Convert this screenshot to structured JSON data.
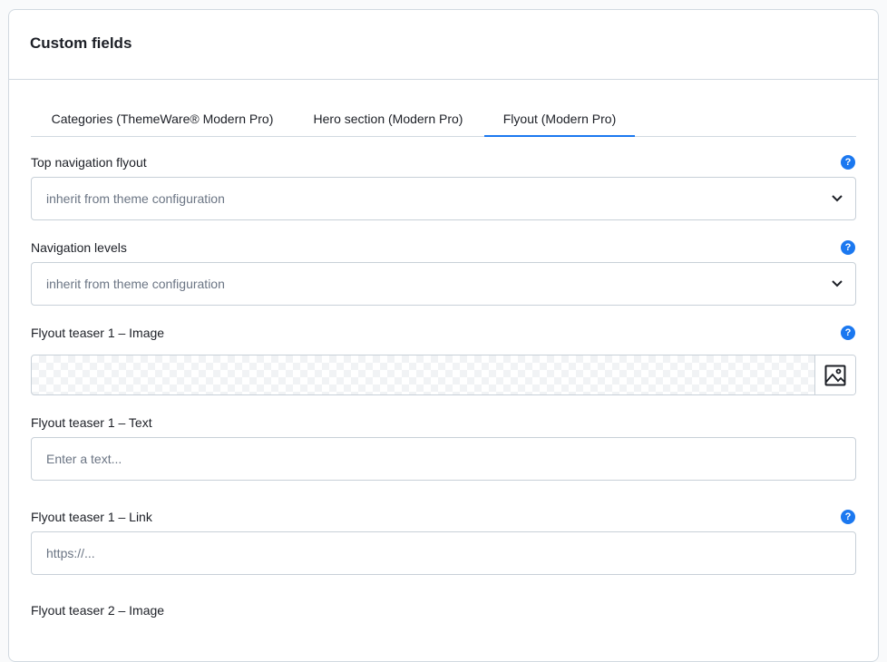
{
  "card": {
    "title": "Custom fields"
  },
  "tabs": [
    {
      "label": "Categories (ThemeWare® Modern Pro)",
      "active": false
    },
    {
      "label": "Hero section (Modern Pro)",
      "active": false
    },
    {
      "label": "Flyout (Modern Pro)",
      "active": true
    }
  ],
  "fields": {
    "top_nav_flyout": {
      "label": "Top navigation flyout",
      "value": "inherit from theme configuration"
    },
    "nav_levels": {
      "label": "Navigation levels",
      "value": "inherit from theme configuration"
    },
    "teaser1_image": {
      "label": "Flyout teaser 1 – Image"
    },
    "teaser1_text": {
      "label": "Flyout teaser 1 – Text",
      "placeholder": "Enter a text..."
    },
    "teaser1_link": {
      "label": "Flyout teaser 1 – Link",
      "placeholder": "https://..."
    },
    "teaser2_image": {
      "label": "Flyout teaser 2 – Image"
    }
  },
  "help_icon_glyph": "?",
  "colors": {
    "accent": "#1b78f0",
    "border": "#d1d9e0",
    "text": "#1c1f26",
    "muted": "#6b7584"
  },
  "icons": {
    "help": "help-circle-icon",
    "dropdown": "chevron-down-icon",
    "media": "image-icon"
  }
}
